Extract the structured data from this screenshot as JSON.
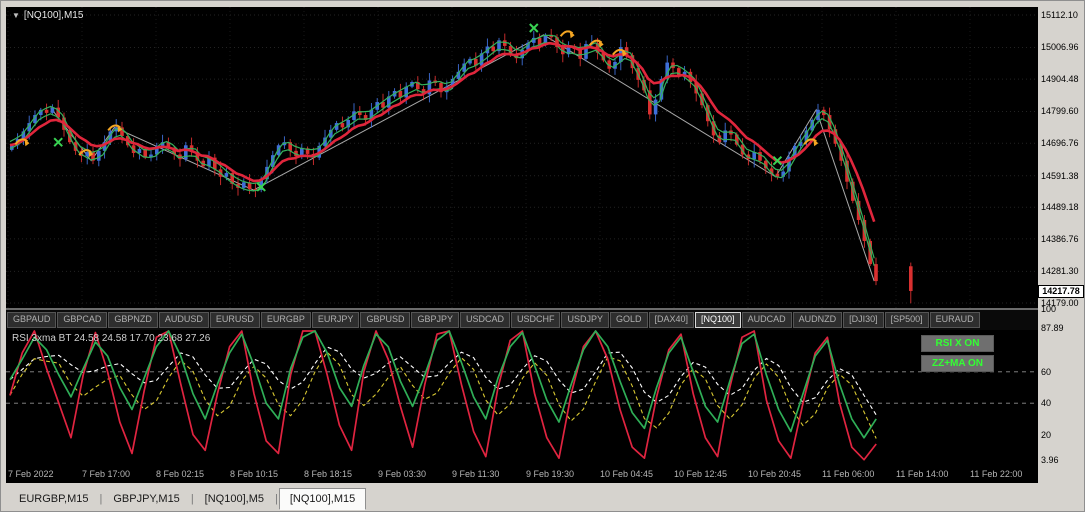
{
  "chart": {
    "title": "[NQ100],M15",
    "collapse_icon": "▼",
    "price_scale": [
      "15112.10",
      "15006.96",
      "14904.48",
      "14799.60",
      "14696.76",
      "14591.38",
      "14489.18",
      "14386.76",
      "14281.30",
      "14179.00"
    ],
    "current_price": "14217.78",
    "price_min": 14179.0,
    "price_max": 15112.1
  },
  "symbol_tabs": {
    "items": [
      "GBPAUD",
      "GBPCAD",
      "GBPNZD",
      "AUDUSD",
      "EURUSD",
      "EURGBP",
      "EURJPY",
      "GBPUSD",
      "GBPJPY",
      "USDCAD",
      "USDCHF",
      "USDJPY",
      "GOLD",
      "[DAX40]",
      "[NQ100]",
      "AUDCAD",
      "AUDNZD",
      "[DJI30]",
      "[SP500]",
      "EURAUD"
    ],
    "active": "[NQ100]"
  },
  "indicator": {
    "label": "RSI 3xma BT 24.58 24.58 17.70 23.68 27.26",
    "buttons": [
      "RSI X ON",
      "ZZ+MA ON"
    ],
    "scale": [
      {
        "v": 100,
        "label": "100"
      },
      {
        "v": 87.89,
        "label": "87.89"
      },
      {
        "v": 60,
        "label": "60"
      },
      {
        "v": 40,
        "label": "40"
      },
      {
        "v": 20,
        "label": "20"
      },
      {
        "v": 3.96,
        "label": "3.96"
      }
    ],
    "levels": [
      60,
      40
    ]
  },
  "time_axis": {
    "labels": [
      "7 Feb 2022",
      "7 Feb 17:00",
      "8 Feb 02:15",
      "8 Feb 10:15",
      "8 Feb 18:15",
      "9 Feb 03:30",
      "9 Feb 11:30",
      "9 Feb 19:30",
      "10 Feb 04:45",
      "10 Feb 12:45",
      "10 Feb 20:45",
      "11 Feb 06:00",
      "11 Feb 14:00",
      "11 Feb 22:00"
    ]
  },
  "bottom_tabs": {
    "items": [
      "EURGBP,M15",
      "GBPJPY,M15",
      "[NQ100],M5",
      "[NQ100],M15"
    ],
    "active_index": 3
  },
  "colors": {
    "chart_bg": "#000000",
    "frame": "#d6d3ce",
    "up": "#3f6fd8",
    "down": "#d93030",
    "ma_fast": "#35b25c",
    "ma_slow": "#e0263c",
    "zigzag": "#a9a9a9",
    "sell_marker": "#f5a623",
    "buy_marker": "#39d353",
    "rsi_green": "#2fae57",
    "rsi_red": "#e02440",
    "rsi_yellow": "#d8c832",
    "rsi_white": "#ffffff",
    "button_bg": "#6f6f6f",
    "button_text": "#33ff33"
  },
  "chart_data": {
    "type": "candlestick",
    "symbol": "[NQ100]",
    "timeframe": "M15",
    "price_range": [
      14179.0,
      15112.1
    ],
    "closes": [
      14690,
      14710,
      14735,
      14762,
      14788,
      14805,
      14795,
      14812,
      14780,
      14740,
      14700,
      14672,
      14655,
      14668,
      14640,
      14672,
      14700,
      14735,
      14748,
      14720,
      14690,
      14665,
      14678,
      14650,
      14660,
      14688,
      14700,
      14682,
      14660,
      14645,
      14690,
      14668,
      14640,
      14622,
      14650,
      14612,
      14588,
      14600,
      14565,
      14552,
      14570,
      14548,
      14545,
      14580,
      14620,
      14658,
      14690,
      14700,
      14672,
      14655,
      14680,
      14662,
      14650,
      14688,
      14715,
      14740,
      14762,
      14748,
      14772,
      14800,
      14788,
      14772,
      14805,
      14830,
      14812,
      14848,
      14866,
      14845,
      14880,
      14895,
      14872,
      14855,
      14900,
      14892,
      14862,
      14880,
      14905,
      14928,
      14955,
      14970,
      14948,
      14988,
      15010,
      14995,
      15030,
      15012,
      14985,
      14972,
      15000,
      15022,
      15038,
      15015,
      15048,
      15040,
      15008,
      14985,
      15012,
      15002,
      14970,
      15018,
      15022,
      14990,
      14965,
      14938,
      14960,
      15008,
      14982,
      14940,
      14902,
      14868,
      14790,
      14838,
      14905,
      14958,
      14940,
      14912,
      14928,
      14895,
      14858,
      14820,
      14768,
      14722,
      14700,
      14738,
      14725,
      14692,
      14660,
      14645,
      14668,
      14640,
      14615,
      14598,
      14588,
      14605,
      14652,
      14688,
      14702,
      14738,
      14772,
      14805,
      14788,
      14742,
      14695,
      14640,
      14572,
      14510,
      14448,
      14380,
      14305,
      14250
    ],
    "last_bar": {
      "gap": 5,
      "open": 14298,
      "high": 14310,
      "low": 14178,
      "close": 14218
    },
    "zigzag": [
      [
        7,
        14812
      ],
      [
        14,
        14640
      ],
      [
        18,
        14748
      ],
      [
        42,
        14545
      ],
      [
        92,
        15048
      ],
      [
        132,
        14588
      ],
      [
        139,
        14805
      ],
      [
        149,
        14250
      ]
    ],
    "markers": [
      {
        "i": 2,
        "p": 14690,
        "k": "sell"
      },
      {
        "i": 8,
        "p": 14700,
        "k": "buy"
      },
      {
        "i": 13,
        "p": 14655,
        "k": "sell"
      },
      {
        "i": 18,
        "p": 14735,
        "k": "sell"
      },
      {
        "i": 43,
        "p": 14555,
        "k": "buy"
      },
      {
        "i": 90,
        "p": 15070,
        "k": "buy"
      },
      {
        "i": 96,
        "p": 15040,
        "k": "sell"
      },
      {
        "i": 101,
        "p": 15010,
        "k": "sell"
      },
      {
        "i": 105,
        "p": 14980,
        "k": "sell"
      },
      {
        "i": 132,
        "p": 14640,
        "k": "buy"
      },
      {
        "i": 138,
        "p": 14690,
        "k": "sell"
      }
    ],
    "rsi": {
      "green": [
        55,
        68,
        82,
        74,
        58,
        44,
        62,
        79,
        70,
        50,
        36,
        56,
        76,
        86,
        70,
        46,
        30,
        52,
        72,
        84,
        64,
        40,
        30,
        62,
        82,
        87,
        72,
        50,
        38,
        64,
        84,
        76,
        54,
        38,
        58,
        80,
        86,
        66,
        44,
        30,
        56,
        76,
        85,
        64,
        42,
        28,
        52,
        74,
        86,
        76,
        54,
        34,
        24,
        50,
        72,
        82,
        60,
        38,
        28,
        54,
        78,
        84,
        58,
        36,
        22,
        46,
        70,
        80,
        52,
        30,
        18,
        30
      ],
      "red": [
        45,
        72,
        88,
        62,
        40,
        18,
        58,
        85,
        60,
        28,
        8,
        48,
        82,
        87,
        52,
        20,
        10,
        46,
        76,
        86,
        46,
        16,
        8,
        58,
        86,
        88,
        58,
        26,
        10,
        60,
        87,
        68,
        38,
        12,
        52,
        84,
        88,
        52,
        22,
        6,
        50,
        80,
        87,
        46,
        18,
        5,
        46,
        76,
        88,
        68,
        36,
        12,
        5,
        44,
        74,
        84,
        46,
        18,
        6,
        50,
        82,
        86,
        42,
        16,
        5,
        40,
        72,
        82,
        40,
        12,
        4,
        14
      ]
    }
  }
}
